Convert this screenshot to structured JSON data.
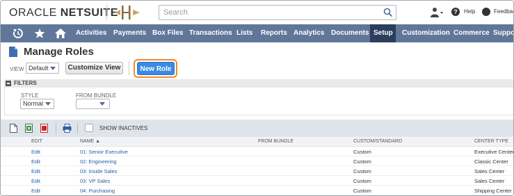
{
  "header": {
    "brand_part1": "ORACLE ",
    "brand_part2": "NETSUITE",
    "search_placeholder": "Search",
    "help_label": "Help",
    "feedback_label": "Feedback"
  },
  "nav": {
    "items": [
      "Activities",
      "Payments",
      "Box Files",
      "Transactions",
      "Lists",
      "Reports",
      "Analytics",
      "Documents",
      "Setup",
      "Customization",
      "Commerce",
      "Support"
    ],
    "active": "Setup"
  },
  "page": {
    "title": "Manage Roles",
    "view_label": "VIEW",
    "view_value": "Default",
    "customize_view_label": "Customize View",
    "new_role_label": "New Role"
  },
  "filters": {
    "title": "FILTERS",
    "style_label": "STYLE",
    "style_value": "Normal",
    "bundle_label": "FROM BUNDLE",
    "bundle_value": ""
  },
  "toolbar": {
    "show_inactives_label": "SHOW INACTIVES"
  },
  "table": {
    "columns": [
      "EDIT",
      "NAME ▲",
      "FROM BUNDLE",
      "CUSTOM/STANDARD",
      "CENTER TYPE"
    ],
    "rows": [
      {
        "edit": "Edit",
        "name": "01: Senior Executive",
        "bundle": "",
        "custom": "Custom",
        "center": "Executive Center"
      },
      {
        "edit": "Edit",
        "name": "02: Engineering",
        "bundle": "",
        "custom": "Custom",
        "center": "Classic Center"
      },
      {
        "edit": "Edit",
        "name": "03: Inside Sales",
        "bundle": "",
        "custom": "Custom",
        "center": "Sales Center"
      },
      {
        "edit": "Edit",
        "name": "03: VP Sales",
        "bundle": "",
        "custom": "Custom",
        "center": "Sales Center"
      },
      {
        "edit": "Edit",
        "name": "04: Purchasing",
        "bundle": "",
        "custom": "Custom",
        "center": "Shipping Center"
      }
    ]
  },
  "colors": {
    "nav_bg": "#607799",
    "nav_active": "#2b3e5c",
    "primary_button": "#3a8ae6",
    "highlight": "#f08a24",
    "link": "#255ba8"
  }
}
